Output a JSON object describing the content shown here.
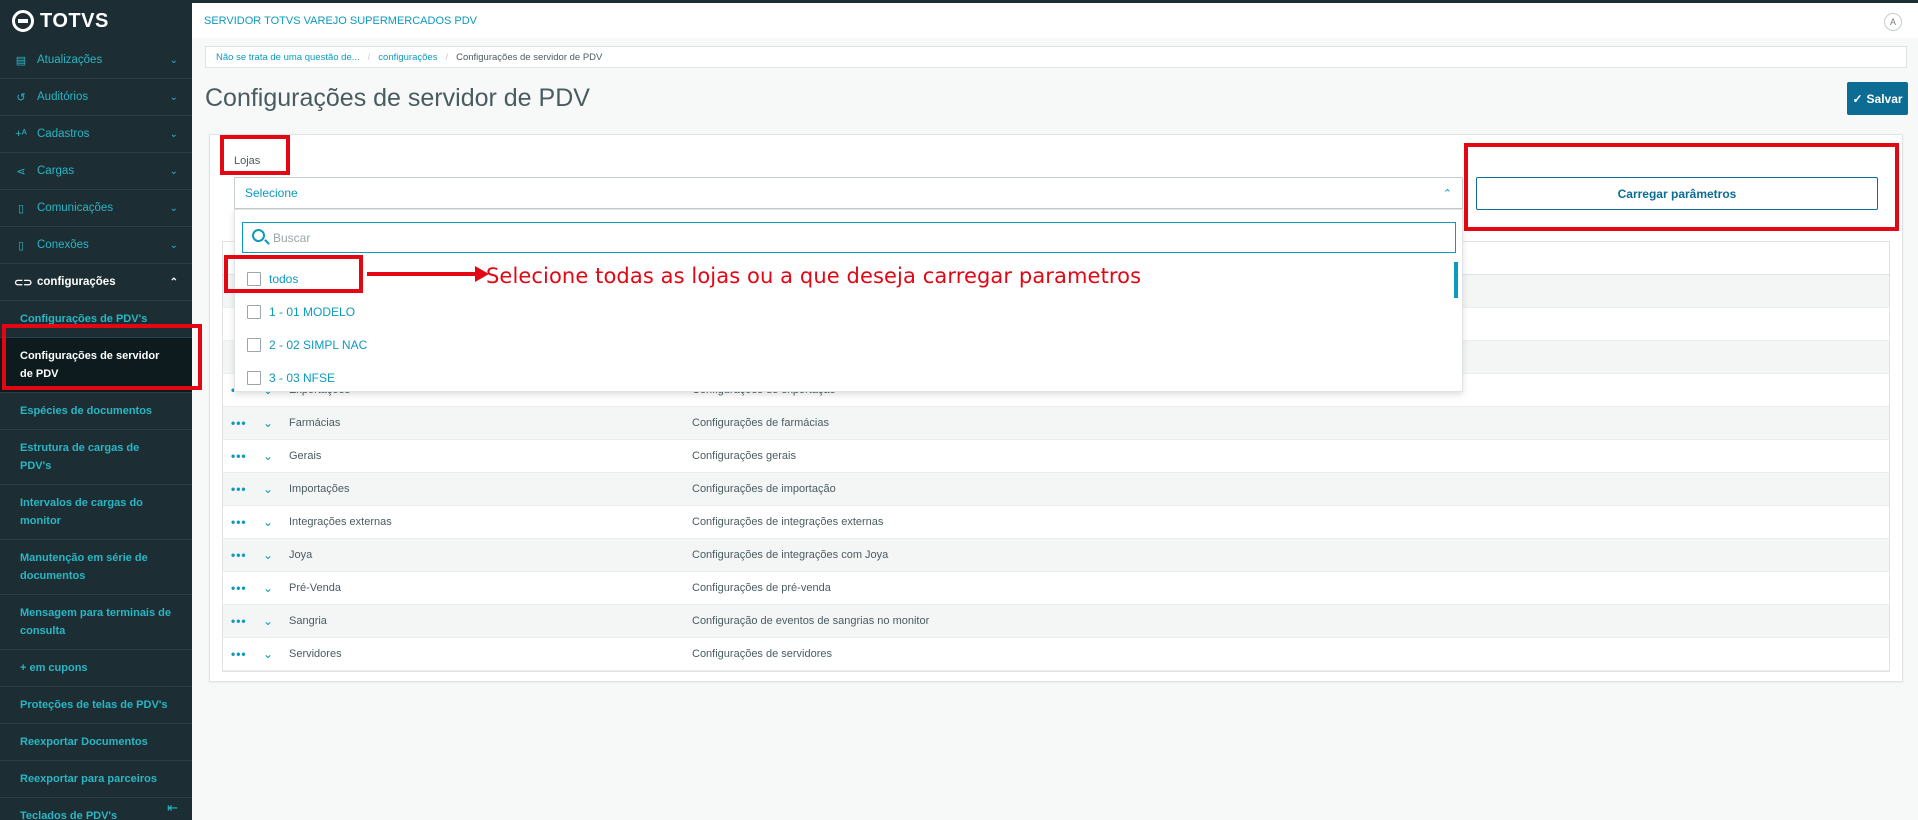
{
  "app": {
    "logo": "TOTVS",
    "title": "SERVIDOR TOTVS VAREJO SUPERMERCADOS PDV",
    "avatar": "A"
  },
  "sidebar": {
    "items": [
      {
        "label": "Atualizações",
        "icon": "database-icon"
      },
      {
        "label": "Auditórios",
        "icon": "history-icon"
      },
      {
        "label": "Cadastros",
        "icon": "add-user-icon"
      },
      {
        "label": "Cargas",
        "icon": "share-icon"
      },
      {
        "label": "Comunicações",
        "icon": "document-icon"
      },
      {
        "label": "Conexões",
        "icon": "document-icon"
      },
      {
        "label": "configurações",
        "icon": "link-icon"
      }
    ],
    "subitems": [
      "Configurações de PDV's",
      "Configurações de servidor de PDV",
      "Espécies de documentos",
      "Estrutura de cargas de PDV's",
      "Intervalos de cargas do monitor",
      "Manutenção em série de documentos",
      "Mensagem para terminais de consulta",
      "+ em cupons",
      "Proteções de telas de PDV's",
      "Reexportar Documentos",
      "Reexportar para parceiros",
      "Teclados de PDV's"
    ]
  },
  "breadcrumb": [
    "Não se trata de uma questão de...",
    "configurações",
    "Configurações de servidor de PDV"
  ],
  "page": {
    "title": "Configurações de servidor de PDV",
    "save_label": "Salvar"
  },
  "form": {
    "lojas_label": "Lojas",
    "select_placeholder": "Selecione",
    "load_button": "Carregar parâmetros",
    "search_placeholder": "Buscar"
  },
  "dropdown": {
    "options": [
      "todos",
      "1 - 01 MODELO",
      "2 - 02 SIMPL NAC",
      "3 - 03 NFSE"
    ]
  },
  "table": {
    "rows": [
      {
        "name": "Exportações",
        "desc": "Configurações de exportação"
      },
      {
        "name": "Farmácias",
        "desc": "Configurações de farmácias"
      },
      {
        "name": "Gerais",
        "desc": "Configurações gerais"
      },
      {
        "name": "Importações",
        "desc": "Configurações de importação"
      },
      {
        "name": "Integrações externas",
        "desc": "Configurações de integrações externas"
      },
      {
        "name": "Joya",
        "desc": "Configurações de integrações com Joya"
      },
      {
        "name": "Pré-Venda",
        "desc": "Configurações de pré-venda"
      },
      {
        "name": "Sangria",
        "desc": "Configuração de eventos de sangrias no monitor"
      },
      {
        "name": "Servidores",
        "desc": "Configurações de servidores"
      }
    ]
  },
  "annotation": {
    "text": "Selecione todas as lojas ou a que deseja carregar parametros",
    "color": "#e30613"
  }
}
